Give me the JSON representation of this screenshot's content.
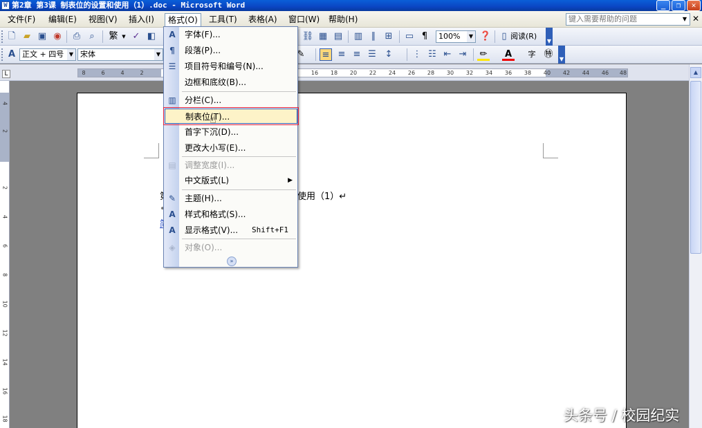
{
  "window": {
    "title": "第2章 第3课 制表位的设置和使用（1）.doc - Microsoft Word",
    "minimize": "_",
    "restore": "❐",
    "close": "✕"
  },
  "menubar": {
    "items": [
      {
        "label": "文件(F)"
      },
      {
        "label": "编辑(E)"
      },
      {
        "label": "视图(V)"
      },
      {
        "label": "插入(I)"
      },
      {
        "label": "格式(O)"
      },
      {
        "label": "工具(T)"
      },
      {
        "label": "表格(A)"
      },
      {
        "label": "窗口(W)"
      },
      {
        "label": "帮助(H)"
      }
    ],
    "help_placeholder": "键入需要帮助的问题",
    "doc_close": "✕"
  },
  "toolbar_standard": {
    "traditional": "繁",
    "zoom": "100%",
    "read_label": "阅读(R)"
  },
  "toolbar_format": {
    "style": "正文 + 四号",
    "font": "宋体"
  },
  "ruler": {
    "h_left": [
      "8",
      "6",
      "4",
      "2"
    ],
    "h_right": [
      "16",
      "18",
      "20",
      "22",
      "24",
      "26",
      "28",
      "30",
      "32",
      "34",
      "36",
      "38",
      "40",
      "42",
      "44",
      "46",
      "48"
    ],
    "v": [
      "4",
      "2",
      "2",
      "4",
      "6",
      "8",
      "10",
      "12",
      "14",
      "16",
      "18"
    ]
  },
  "format_menu": {
    "items": [
      {
        "label": "字体(F)...",
        "icon": "A",
        "disabled": false
      },
      {
        "label": "段落(P)...",
        "icon": "¶",
        "disabled": false
      },
      {
        "label": "项目符号和编号(N)...",
        "icon": "☰",
        "disabled": false
      },
      {
        "label": "边框和底纹(B)...",
        "icon": "",
        "disabled": false
      },
      {
        "label": "分栏(C)...",
        "icon": "▥",
        "disabled": false
      },
      {
        "label": "制表位(T)...",
        "icon": "",
        "disabled": false,
        "highlighted": true
      },
      {
        "label": "首字下沉(D)...",
        "icon": "",
        "disabled": false
      },
      {
        "label": "更改大小写(E)...",
        "icon": "",
        "disabled": false
      },
      {
        "label": "调整宽度(I)...",
        "icon": "▤",
        "disabled": true
      },
      {
        "label": "中文版式(L)",
        "icon": "",
        "disabled": false,
        "submenu": true
      },
      {
        "label": "主题(H)...",
        "icon": "✎",
        "disabled": false
      },
      {
        "label": "样式和格式(S)...",
        "icon": "A",
        "disabled": false
      },
      {
        "label": "显示格式(V)...",
        "icon": "A",
        "disabled": false,
        "shortcut": "Shift+F1"
      },
      {
        "label": "对象(O)...",
        "icon": "◈",
        "disabled": true
      }
    ],
    "expand": "»"
  },
  "document": {
    "line1": "第",
    "line1_end": "使用（1）↵",
    "marker1": "•",
    "marker2": "简"
  },
  "watermark": "头条号 / 校园纪实"
}
